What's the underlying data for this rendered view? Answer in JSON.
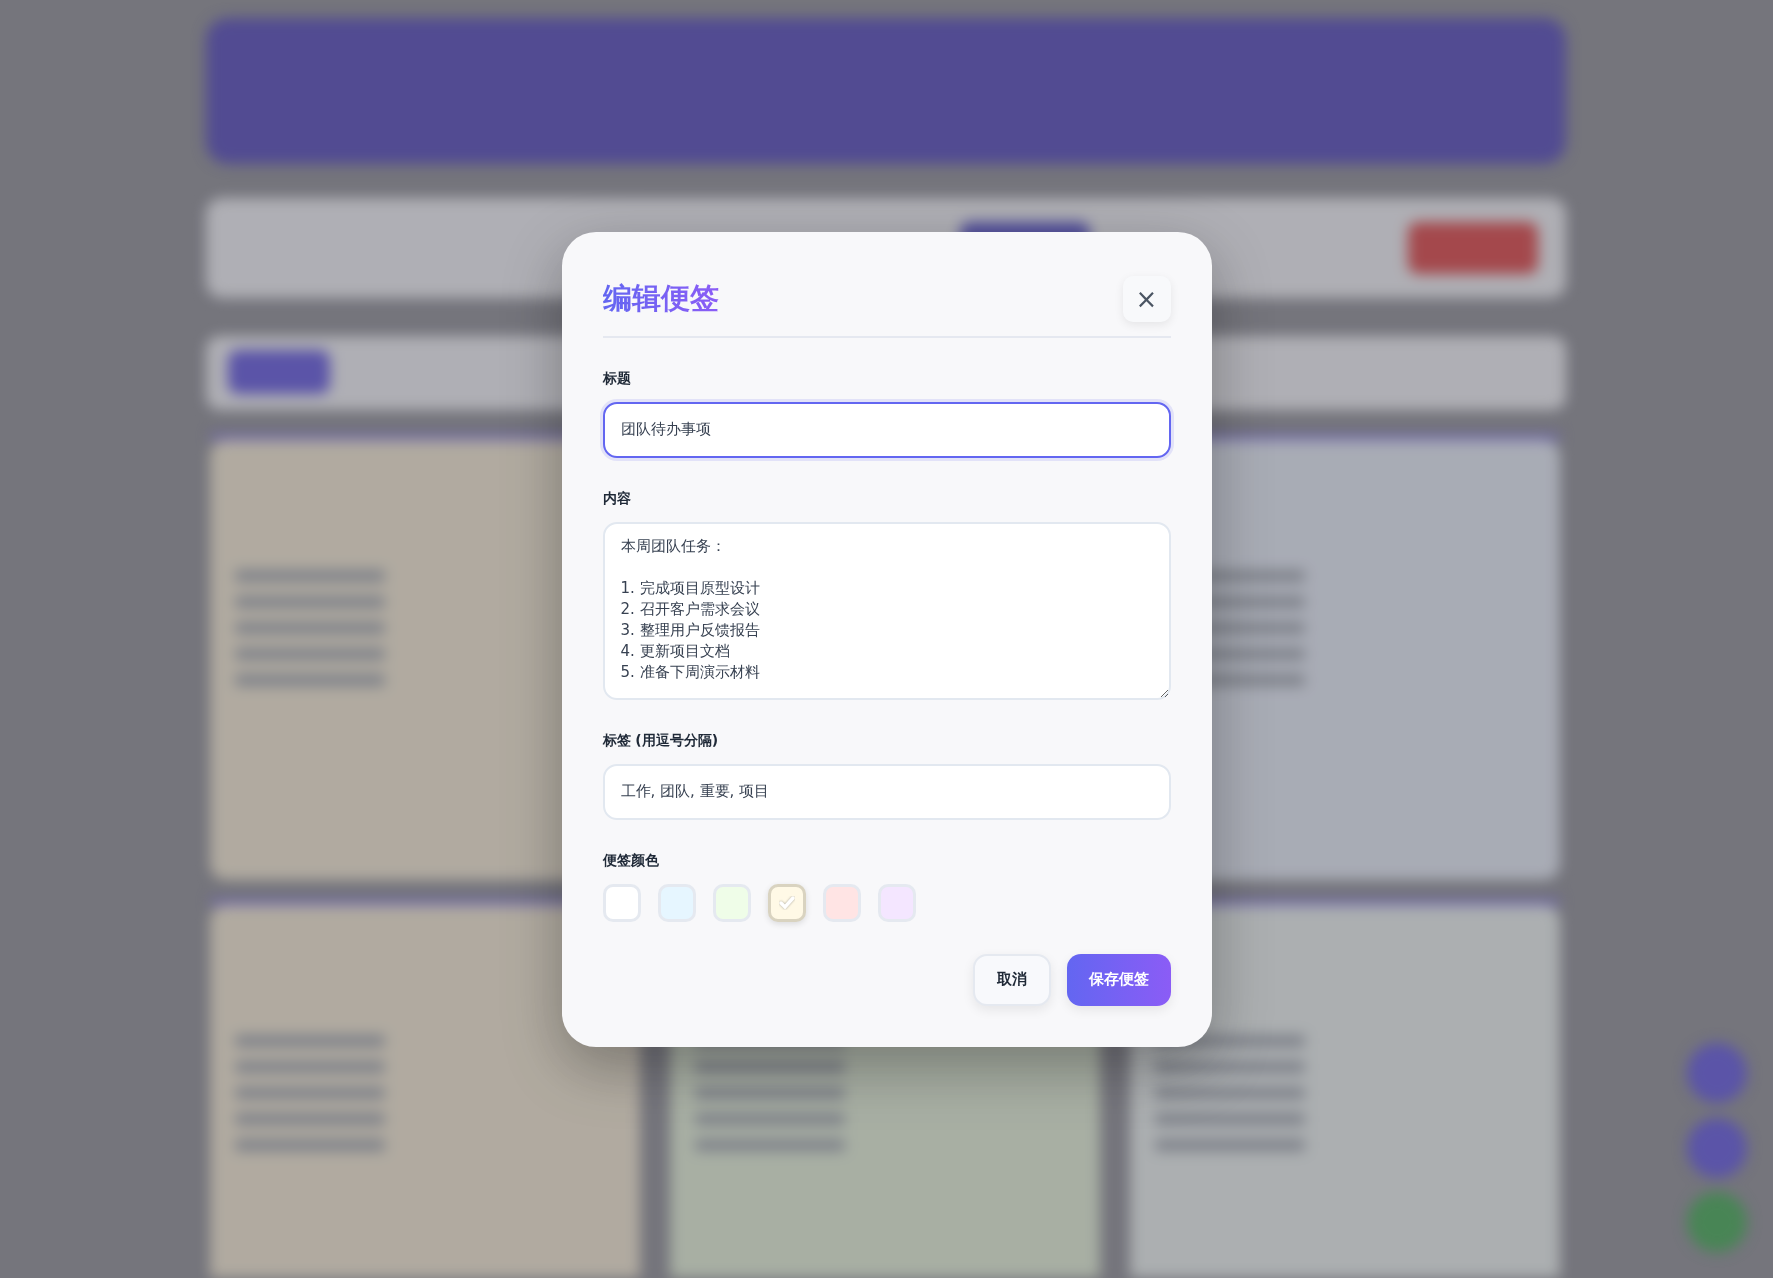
{
  "dialog": {
    "title": "编辑便签",
    "close": "×",
    "fields": [
      {
        "kind": "input",
        "label": "标题",
        "value": "团队待办事项",
        "focused": true
      },
      {
        "kind": "textarea",
        "label": "内容",
        "heading": "本周团队任务：",
        "lines": [
          "1. 完成项目原型设计",
          "2. 召开客户需求会议",
          "3. 整理用户反馈报告",
          "4. 更新项目文档",
          "5. 准备下周演示材料"
        ]
      },
      {
        "kind": "input",
        "label": "标签 (用逗号分隔)",
        "value": "工作, 团队, 重要, 项目",
        "focused": false
      }
    ],
    "color_label": "便签颜色",
    "colors": [
      {
        "color": "#ffffff",
        "selected": false
      },
      {
        "color": "#e6f6ff",
        "selected": false
      },
      {
        "color": "#effde8",
        "selected": false
      },
      {
        "color": "#fff9e6",
        "selected": true
      },
      {
        "color": "#ffe4e4",
        "selected": false
      },
      {
        "color": "#f4e6ff",
        "selected": false
      }
    ],
    "buttons": [
      {
        "kind": "secondary",
        "label": "取消"
      },
      {
        "kind": "primary",
        "label": "保存便签"
      }
    ]
  }
}
